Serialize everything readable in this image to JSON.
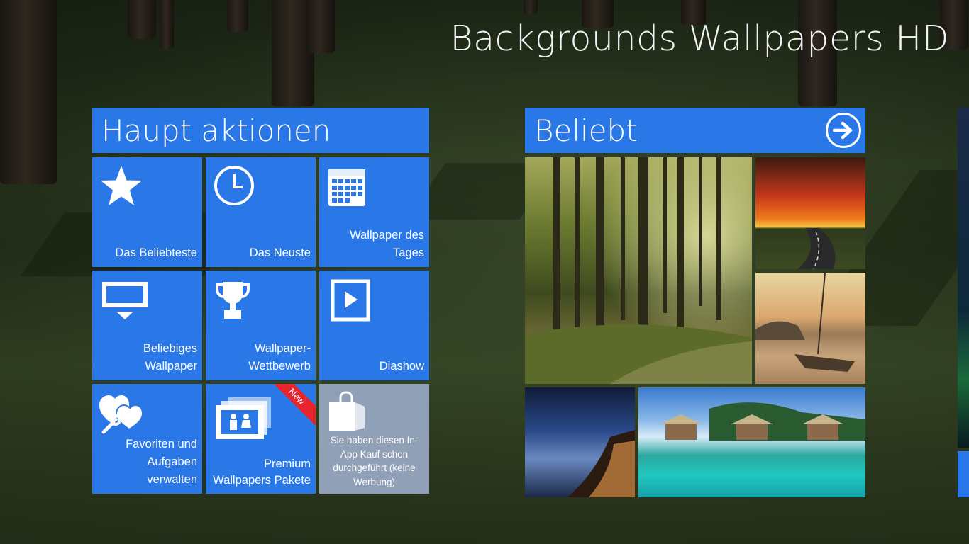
{
  "app": {
    "title": "Backgrounds Wallpapers HD"
  },
  "groups": {
    "main": {
      "title": "Haupt aktionen",
      "tiles": [
        {
          "label": "Das Beliebteste",
          "icon": "star-icon"
        },
        {
          "label": "Das Neuste",
          "icon": "clock-icon"
        },
        {
          "label_lines": [
            "Wallpaper des",
            "Tages"
          ],
          "icon": "calendar-icon"
        },
        {
          "label_lines": [
            "Beliebiges",
            "Wallpaper"
          ],
          "icon": "monitor-icon"
        },
        {
          "label_lines": [
            "Wallpaper-",
            "Wettbewerb"
          ],
          "icon": "trophy-icon"
        },
        {
          "label": "Diashow",
          "icon": "slideshow-play-icon"
        },
        {
          "label_lines": [
            "Favoriten und",
            "Aufgaben",
            "verwalten"
          ],
          "icon": "hearts-wrench-icon"
        },
        {
          "label_lines": [
            "Premium",
            "Wallpapers Pakete"
          ],
          "icon": "premium-packs-icon",
          "badge": "New"
        },
        {
          "label_lines": [
            "Sie haben diesen In-",
            "App Kauf schon",
            "durchgeführt (keine",
            "Werbung)"
          ],
          "icon": "shopping-bag-icon"
        }
      ]
    },
    "popular": {
      "title": "Beliebt",
      "photos": [
        "forest",
        "sunset-road",
        "beach-boat",
        "city-night-sky",
        "tropical-bungalows"
      ]
    }
  },
  "colors": {
    "tile_blue": "#2a78e8",
    "tile_gray": "#8fa0b7",
    "badge_red": "#e8252d"
  }
}
